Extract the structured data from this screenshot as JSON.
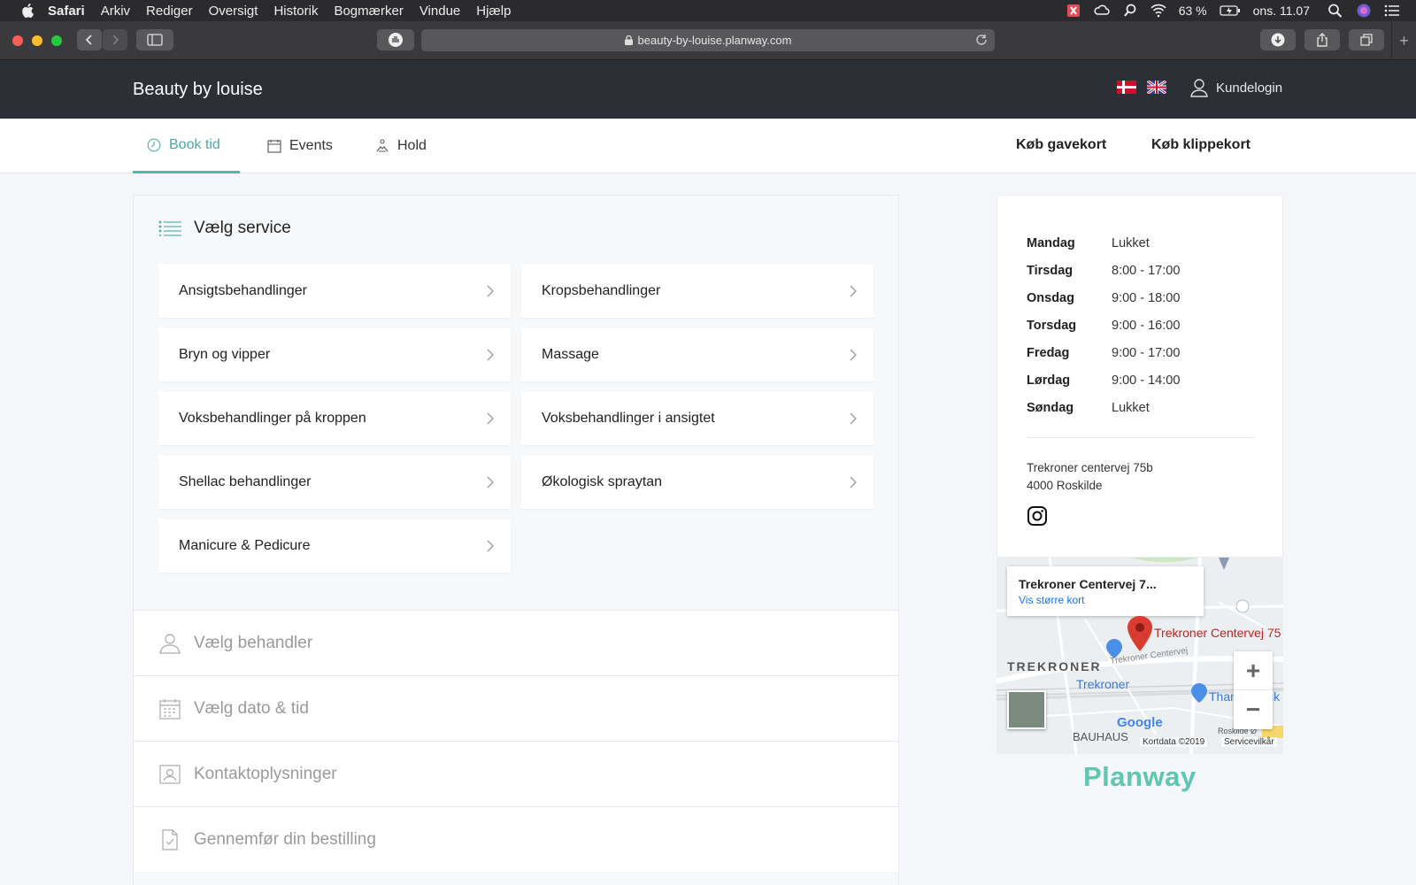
{
  "menubar": {
    "app": "Safari",
    "items": [
      "Arkiv",
      "Rediger",
      "Oversigt",
      "Historik",
      "Bogmærker",
      "Vindue",
      "Hjælp"
    ],
    "battery": "63 %",
    "clock": "ons. 11.07"
  },
  "browser": {
    "url": "beauty-by-louise.planway.com"
  },
  "site": {
    "brand": "Beauty by louise",
    "login": "Kundelogin",
    "tabs": [
      {
        "label": "Book tid",
        "icon": "clock-icon"
      },
      {
        "label": "Events",
        "icon": "calendar-icon"
      },
      {
        "label": "Hold",
        "icon": "yoga-icon"
      }
    ],
    "links": [
      "Køb gavekort",
      "Køb klippekort"
    ]
  },
  "services": {
    "heading": "Vælg service",
    "items": [
      "Ansigtsbehandlinger",
      "Kropsbehandlinger",
      "Bryn og vipper",
      "Massage",
      "Voksbehandlinger på kroppen",
      "Voksbehandlinger i ansigtet",
      "Shellac behandlinger",
      "Økologisk spraytan",
      "Manicure & Pedicure"
    ]
  },
  "steps": [
    "Vælg behandler",
    "Vælg dato & tid",
    "Kontaktoplysninger",
    "Gennemfør din bestilling"
  ],
  "hours": [
    {
      "day": "Mandag",
      "time": "Lukket"
    },
    {
      "day": "Tirsdag",
      "time": "8:00 - 17:00"
    },
    {
      "day": "Onsdag",
      "time": "9:00 - 18:00"
    },
    {
      "day": "Torsdag",
      "time": "9:00 - 16:00"
    },
    {
      "day": "Fredag",
      "time": "9:00 - 17:00"
    },
    {
      "day": "Lørdag",
      "time": "9:00 - 14:00"
    },
    {
      "day": "Søndag",
      "time": "Lukket"
    }
  ],
  "address": {
    "line1": "Trekroner centervej 75b",
    "line2": "4000 Roskilde"
  },
  "map": {
    "card_title": "Trekroner Centervej 7...",
    "card_link": "Vis større kort",
    "pin_label": "Trekroner Centervej 75",
    "area_label": "TREKRONER",
    "road_label": "Trekroner Centervej",
    "station_label": "Trekroner",
    "store_label": "Thansen ask",
    "bauhaus": "BAUHAUS",
    "roskilde": "Roskilde Ø",
    "google": "Google",
    "kortdata": "Kortdata ©2019",
    "terms": "Servicevilkår"
  },
  "footer_logo": "Planway"
}
